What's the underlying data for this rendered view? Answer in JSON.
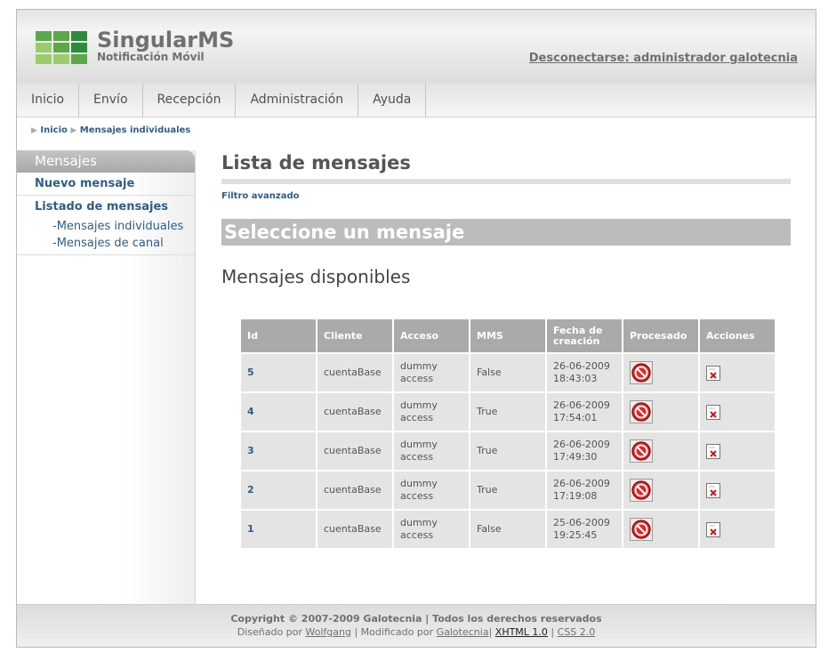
{
  "header": {
    "brand": "SingularMS",
    "tagline": "Notificación Móvil",
    "logout": "Desconectarse: administrador galotecnia",
    "logo_colors": [
      "#5aa84a",
      "#9ccc6a",
      "#2e8b3e",
      "#9ccc6a"
    ]
  },
  "nav": [
    "Inicio",
    "Envío",
    "Recepción",
    "Administración",
    "Ayuda"
  ],
  "breadcrumb": [
    "Inicio",
    "Mensajes individuales"
  ],
  "sidebar": {
    "title": "Mensajes",
    "new_message": "Nuevo mensaje",
    "list_title": "Listado de mensajes",
    "sub_items": [
      "-Mensajes individuales",
      "-Mensajes de canal"
    ]
  },
  "main": {
    "title": "Lista de mensajes",
    "filter_link": "Filtro avanzado",
    "banner": "Seleccione un mensaje",
    "subtitle": "Mensajes disponibles"
  },
  "table": {
    "headers": [
      "Id",
      "Cliente",
      "Acceso",
      "MMS",
      "Fecha de creación",
      "Procesado",
      "Acciones"
    ],
    "rows": [
      {
        "id": "5",
        "cliente": "cuentaBase",
        "acceso": "dummy access",
        "mms": "False",
        "fecha": "26-06-2009 18:43:03"
      },
      {
        "id": "4",
        "cliente": "cuentaBase",
        "acceso": "dummy access",
        "mms": "True",
        "fecha": "26-06-2009 17:54:01"
      },
      {
        "id": "3",
        "cliente": "cuentaBase",
        "acceso": "dummy access",
        "mms": "True",
        "fecha": "26-06-2009 17:49:30"
      },
      {
        "id": "2",
        "cliente": "cuentaBase",
        "acceso": "dummy access",
        "mms": "True",
        "fecha": "26-06-2009 17:19:08"
      },
      {
        "id": "1",
        "cliente": "cuentaBase",
        "acceso": "dummy access",
        "mms": "False",
        "fecha": "25-06-2009 19:25:45"
      }
    ],
    "processed_icon": "stop-icon",
    "action_icon": "delete-icon"
  },
  "footer": {
    "copyright": "Copyright © 2007-2009 Galotecnia | Todos los derechos reservados",
    "designed_prefix": "Diseñado por",
    "designer": "Wolfgang",
    "modified_prefix": "| Modificado por",
    "modifier": "Galotecnia",
    "xhtml": "XHTML 1.0",
    "css": "CSS 2.0"
  }
}
